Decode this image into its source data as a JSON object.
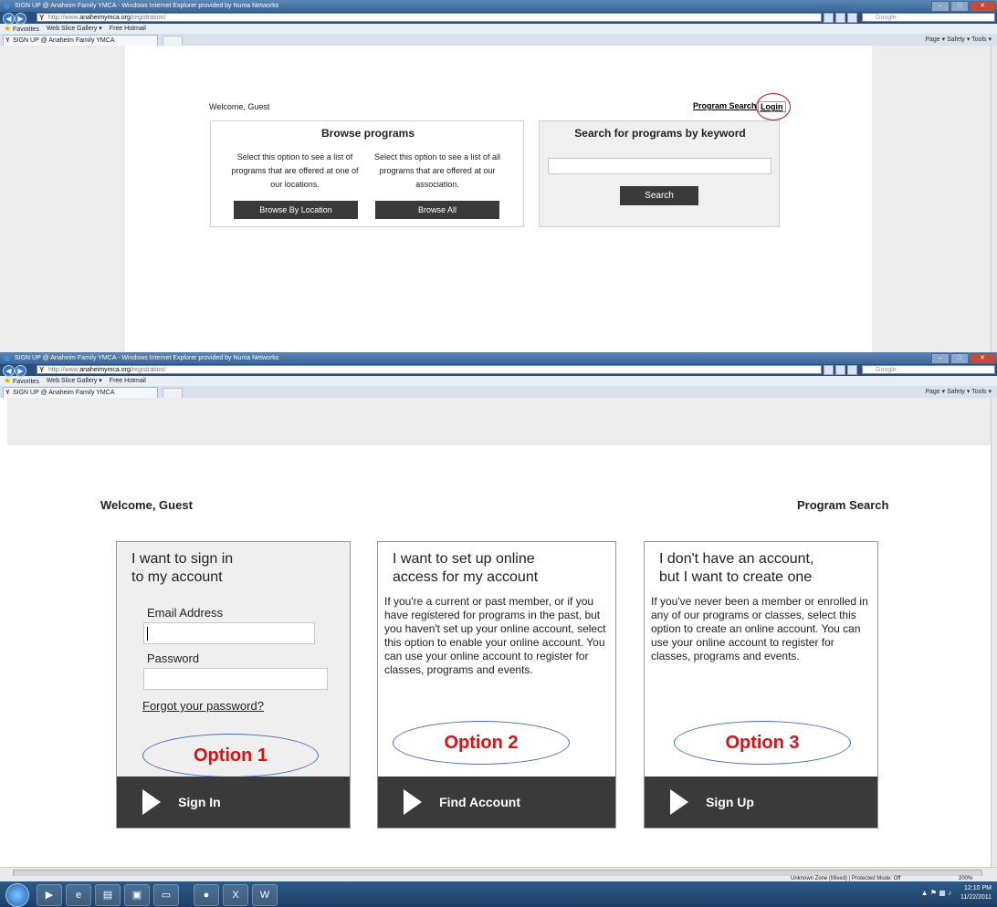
{
  "browser": {
    "title": "SIGN UP @ Anaheim Family YMCA - Windows Internet Explorer provided by Numa Networks",
    "url_prefix": "http://www.",
    "url_host": "anaheimymca.org",
    "url_path": "/registration/",
    "search_engine": "Google",
    "favorites_label": "Favorites",
    "web_slice_gallery": "Web Slice Gallery ▾",
    "free_hotmail": "Free Hotmail",
    "tab_title": "SIGN UP @ Anaheim Family YMCA",
    "command_bar": "Page ▾   Safety ▾   Tools ▾",
    "status_text": "Unknown Zone (Mixed) | Protected Mode: Off",
    "zoom": "200%",
    "clock_time": "12:10 PM",
    "clock_date": "11/22/2011"
  },
  "top_page": {
    "welcome": "Welcome, Guest",
    "program_search": "Program Search",
    "login": "Login",
    "browse_title": "Browse programs",
    "browse_location_desc": "Select this option to see a list of programs that are offered at one of our locations.",
    "browse_all_desc": "Select this option to see a list of all programs that are offered at our association.",
    "browse_location_btn": "Browse By Location",
    "browse_all_btn": "Browse All",
    "search_title": "Search for programs by keyword",
    "search_value": "",
    "search_btn": "Search"
  },
  "bottom_page": {
    "welcome": "Welcome, Guest",
    "program_search": "Program Search",
    "card1": {
      "title_line1": "I want to sign in",
      "title_line2": "to my account",
      "email_label": "Email Address",
      "email_value": "",
      "password_label": "Password",
      "password_value": "",
      "forgot": "Forgot your password?",
      "annotation": "Option 1",
      "button": "Sign In"
    },
    "card2": {
      "title_line1": "I want to set up online",
      "title_line2": "access for my account",
      "body": "If you're a current or past member, or if you have registered for programs in the past, but you haven't set up your online account, select this option to enable your online account. You can use your online account to register for classes, programs and events.",
      "annotation": "Option 2",
      "button": "Find Account"
    },
    "card3": {
      "title_line1": "I don't have an account,",
      "title_line2": "but I want to create one",
      "body": "If you've never been a member or enrolled in any of our programs or classes, select this option to create an online account. You can use your online account to register for classes, programs and events.",
      "annotation": "Option 3",
      "button": "Sign Up"
    }
  },
  "colors": {
    "annotation_text": "#e01010",
    "annotation_oval": "#4472c4",
    "login_circle": "#d01010",
    "dark_button": "#3a3a3a"
  }
}
